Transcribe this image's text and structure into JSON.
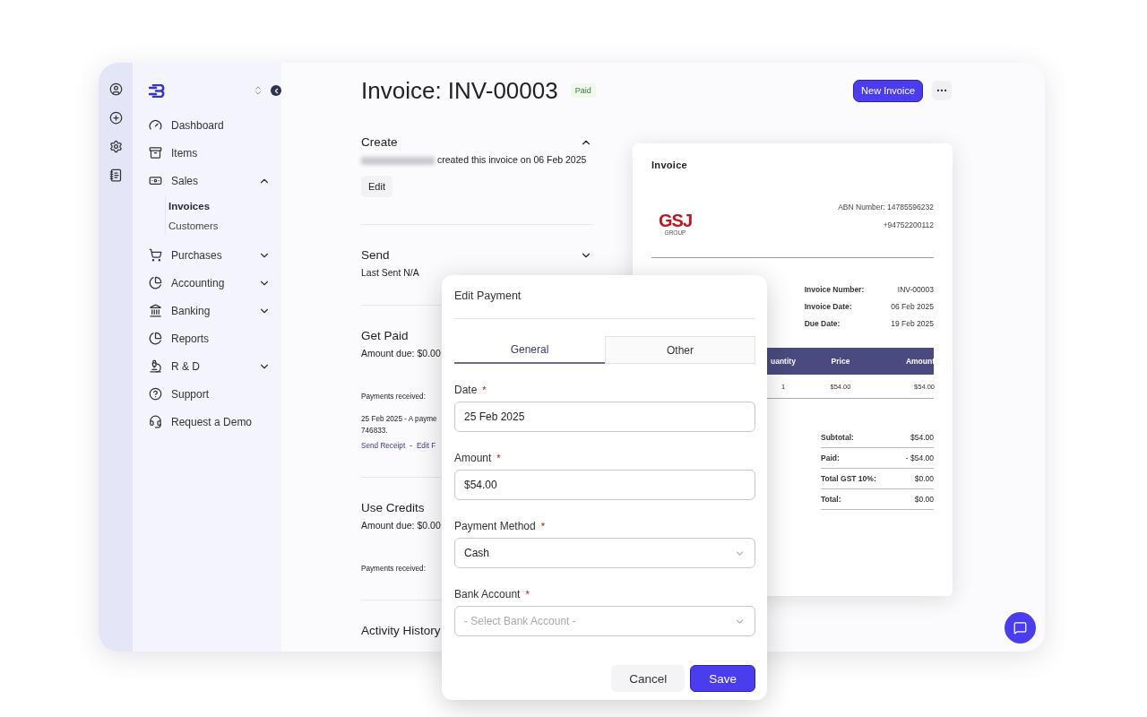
{
  "sidebar": {
    "items": [
      {
        "label": "Dashboard",
        "kind": "link"
      },
      {
        "label": "Items",
        "kind": "link"
      },
      {
        "label": "Sales",
        "kind": "group",
        "expanded": true,
        "children": [
          {
            "label": "Invoices",
            "selected": true
          },
          {
            "label": "Customers",
            "selected": false
          }
        ]
      },
      {
        "label": "Purchases",
        "kind": "group",
        "expanded": false
      },
      {
        "label": "Accounting",
        "kind": "group",
        "expanded": false
      },
      {
        "label": "Banking",
        "kind": "group",
        "expanded": false
      },
      {
        "label": "Reports",
        "kind": "link"
      },
      {
        "label": "R & D",
        "kind": "group",
        "expanded": false
      },
      {
        "label": "Support",
        "kind": "link"
      },
      {
        "label": "Request a Demo",
        "kind": "link"
      }
    ]
  },
  "header": {
    "title": "Invoice: INV-00003",
    "status": "Paid",
    "primary_button": "New Invoice"
  },
  "sections": [
    {
      "title": "Create",
      "expanded": true,
      "text": "created this invoice on 06 Feb 2025",
      "redacted_name": true,
      "button": "Edit"
    },
    {
      "title": "Send",
      "expanded": false,
      "text": "Last Sent N/A"
    },
    {
      "title": "Get Paid",
      "text": "Amount due: $0.00",
      "received_label": "Payments received:",
      "entry": [
        "25 Feb 2025 - A payme",
        "746833."
      ],
      "links": [
        "Send Receipt",
        "-",
        "Edit F"
      ]
    },
    {
      "title": "Use Credits",
      "text": "Amount due: $0.00",
      "received_label": "Payments received:"
    },
    {
      "title": "Activity History"
    }
  ],
  "invoice_preview": {
    "title": "Invoice",
    "logo": {
      "mark": "GSJ",
      "sub": "GROUP"
    },
    "abn": "ABN Number: 14785596232",
    "phone": "+94752200112",
    "details": [
      {
        "label": "Invoice Number:",
        "value": "INV-00003"
      },
      {
        "label": "Invoice Date:",
        "value": "06 Feb 2025"
      },
      {
        "label": "Due Date:",
        "value": "19 Feb 2025"
      }
    ],
    "table": {
      "columns": [
        "uantity",
        "Price",
        "Amount"
      ],
      "rows": [
        [
          "1",
          "$54.00",
          "$54.00"
        ]
      ]
    },
    "totals": [
      {
        "label": "Subtotal:",
        "value": "$54.00"
      },
      {
        "label": "Paid:",
        "value": "- $54.00"
      },
      {
        "label": "Total GST 10%:",
        "value": "$0.00"
      },
      {
        "label": "Total:",
        "value": "$0.00"
      }
    ]
  },
  "modal": {
    "title": "Edit Payment",
    "required_mark": "*",
    "tabs": [
      {
        "label": "General",
        "selected": true
      },
      {
        "label": "Other",
        "selected": false
      }
    ],
    "fields": [
      {
        "label": "Date",
        "required": true,
        "kind": "text",
        "value": "25 Feb 2025"
      },
      {
        "label": "Amount",
        "required": true,
        "kind": "text",
        "value": "$54.00"
      },
      {
        "label": "Payment Method",
        "required": true,
        "kind": "select",
        "value": "Cash"
      },
      {
        "label": "Bank Account",
        "required": true,
        "kind": "select",
        "placeholder": "- Select Bank Account -"
      }
    ],
    "buttons": [
      {
        "label": "Cancel",
        "kind": "secondary"
      },
      {
        "label": "Save",
        "kind": "primary"
      }
    ]
  }
}
